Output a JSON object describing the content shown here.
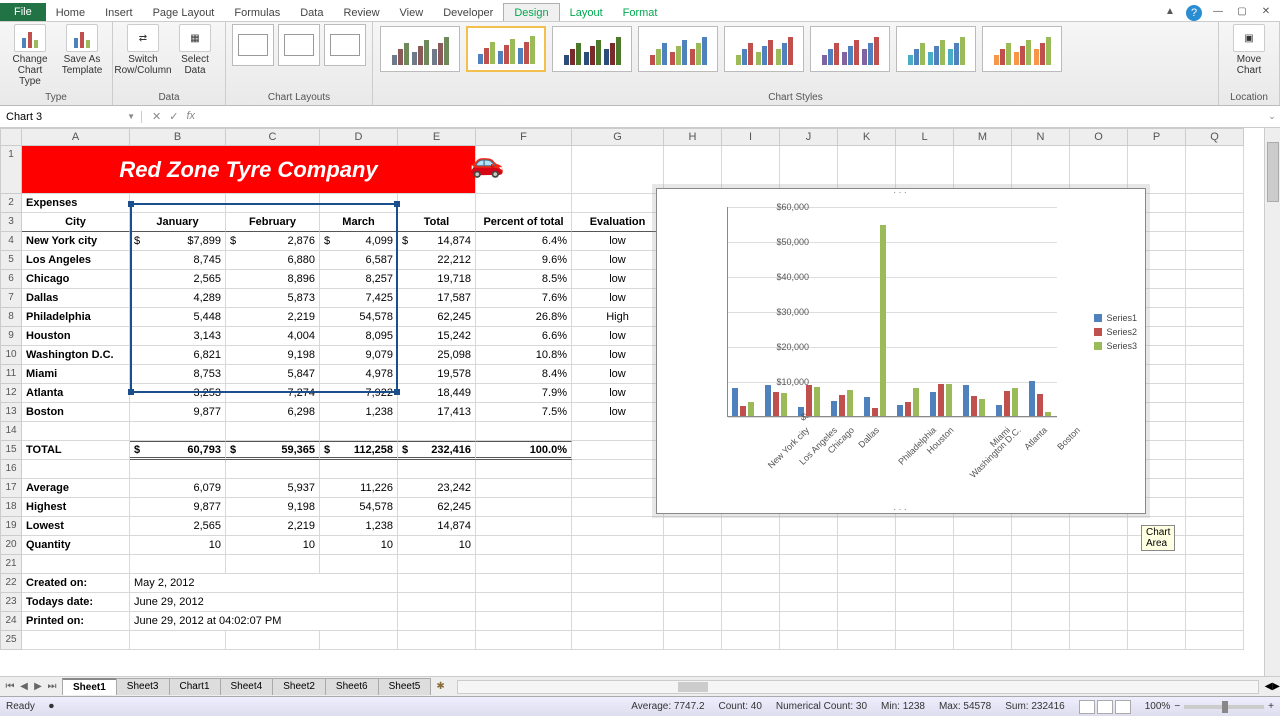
{
  "tabs": {
    "file": "File",
    "home": "Home",
    "insert": "Insert",
    "pagelayout": "Page Layout",
    "formulas": "Formulas",
    "data": "Data",
    "review": "Review",
    "view": "View",
    "developer": "Developer",
    "design": "Design",
    "layout": "Layout",
    "format": "Format"
  },
  "ribbon": {
    "type": {
      "change": "Change Chart Type",
      "saveas": "Save As Template",
      "label": "Type"
    },
    "data": {
      "switch": "Switch Row/Column",
      "select": "Select Data",
      "label": "Data"
    },
    "layouts": {
      "label": "Chart Layouts"
    },
    "styles": {
      "label": "Chart Styles"
    },
    "location": {
      "move": "Move Chart",
      "label": "Location"
    }
  },
  "namebox": "Chart 3",
  "fx_label": "fx",
  "columns": [
    "A",
    "B",
    "C",
    "D",
    "E",
    "F",
    "G",
    "H",
    "I",
    "J",
    "K",
    "L",
    "M",
    "N",
    "O",
    "P",
    "Q"
  ],
  "banner": "Red Zone Tyre Company",
  "headers": {
    "expenses": "Expenses",
    "city": "City",
    "jan": "January",
    "feb": "February",
    "mar": "March",
    "total": "Total",
    "pct": "Percent of total",
    "eval": "Evaluation"
  },
  "rows": [
    {
      "city": "New York city",
      "jan": "7,899",
      "feb": "2,876",
      "mar": "4,099",
      "total": "14,874",
      "pct": "6.4%",
      "eval": "low",
      "cur": "$"
    },
    {
      "city": "Los Angeles",
      "jan": "8,745",
      "feb": "6,880",
      "mar": "6,587",
      "total": "22,212",
      "pct": "9.6%",
      "eval": "low"
    },
    {
      "city": "Chicago",
      "jan": "2,565",
      "feb": "8,896",
      "mar": "8,257",
      "total": "19,718",
      "pct": "8.5%",
      "eval": "low"
    },
    {
      "city": "Dallas",
      "jan": "4,289",
      "feb": "5,873",
      "mar": "7,425",
      "total": "17,587",
      "pct": "7.6%",
      "eval": "low"
    },
    {
      "city": "Philadelphia",
      "jan": "5,448",
      "feb": "2,219",
      "mar": "54,578",
      "total": "62,245",
      "pct": "26.8%",
      "eval": "High"
    },
    {
      "city": "Houston",
      "jan": "3,143",
      "feb": "4,004",
      "mar": "8,095",
      "total": "15,242",
      "pct": "6.6%",
      "eval": "low"
    },
    {
      "city": "Washington D.C.",
      "jan": "6,821",
      "feb": "9,198",
      "mar": "9,079",
      "total": "25,098",
      "pct": "10.8%",
      "eval": "low"
    },
    {
      "city": "Miami",
      "jan": "8,753",
      "feb": "5,847",
      "mar": "4,978",
      "total": "19,578",
      "pct": "8.4%",
      "eval": "low"
    },
    {
      "city": "Atlanta",
      "jan": "3,253",
      "feb": "7,274",
      "mar": "7,922",
      "total": "18,449",
      "pct": "7.9%",
      "eval": "low"
    },
    {
      "city": "Boston",
      "jan": "9,877",
      "feb": "6,298",
      "mar": "1,238",
      "total": "17,413",
      "pct": "7.5%",
      "eval": "low"
    }
  ],
  "totals": {
    "label": "TOTAL",
    "jan": "60,793",
    "feb": "59,365",
    "mar": "112,258",
    "total": "232,416",
    "pct": "100.0%",
    "cur": "$"
  },
  "stats": {
    "avg": {
      "label": "Average",
      "jan": "6,079",
      "feb": "5,937",
      "mar": "11,226",
      "total": "23,242"
    },
    "hi": {
      "label": "Highest",
      "jan": "9,877",
      "feb": "9,198",
      "mar": "54,578",
      "total": "62,245"
    },
    "lo": {
      "label": "Lowest",
      "jan": "2,565",
      "feb": "2,219",
      "mar": "1,238",
      "total": "14,874"
    },
    "qty": {
      "label": "Quantity",
      "jan": "10",
      "feb": "10",
      "mar": "10",
      "total": "10"
    }
  },
  "meta": {
    "created_l": "Created on:",
    "created_v": "May 2, 2012",
    "today_l": "Todays date:",
    "today_v": "June 29, 2012",
    "printed_l": "Printed on:",
    "printed_v": "June 29, 2012 at 04:02:07 PM"
  },
  "chart_data": {
    "type": "bar",
    "categories": [
      "New York city",
      "Los Angeles",
      "Chicago",
      "Dallas",
      "Philadelphia",
      "Houston",
      "Washington D.C.",
      "Miami",
      "Atlanta",
      "Boston"
    ],
    "series": [
      {
        "name": "Series1",
        "values": [
          7899,
          8745,
          2565,
          4289,
          5448,
          3143,
          6821,
          8753,
          3253,
          9877
        ],
        "color": "#4f81bd"
      },
      {
        "name": "Series2",
        "values": [
          2876,
          6880,
          8896,
          5873,
          2219,
          4004,
          9198,
          5847,
          7274,
          6298
        ],
        "color": "#c0504d"
      },
      {
        "name": "Series3",
        "values": [
          4099,
          6587,
          8257,
          7425,
          54578,
          8095,
          9079,
          4978,
          7922,
          1238
        ],
        "color": "#9bbb59"
      }
    ],
    "ylim": [
      0,
      60000
    ],
    "yticks": [
      "$-",
      "$10,000",
      "$20,000",
      "$30,000",
      "$40,000",
      "$50,000",
      "$60,000"
    ],
    "legend": [
      "Series1",
      "Series2",
      "Series3"
    ]
  },
  "tooltip": "Chart Area",
  "sheets": [
    "Sheet1",
    "Sheet3",
    "Chart1",
    "Sheet4",
    "Sheet2",
    "Sheet6",
    "Sheet5"
  ],
  "status": {
    "ready": "Ready",
    "avg": "Average: 7747.2",
    "count": "Count: 40",
    "ncount": "Numerical Count: 30",
    "min": "Min: 1238",
    "max": "Max: 54578",
    "sum": "Sum: 232416",
    "zoom": "100%"
  }
}
